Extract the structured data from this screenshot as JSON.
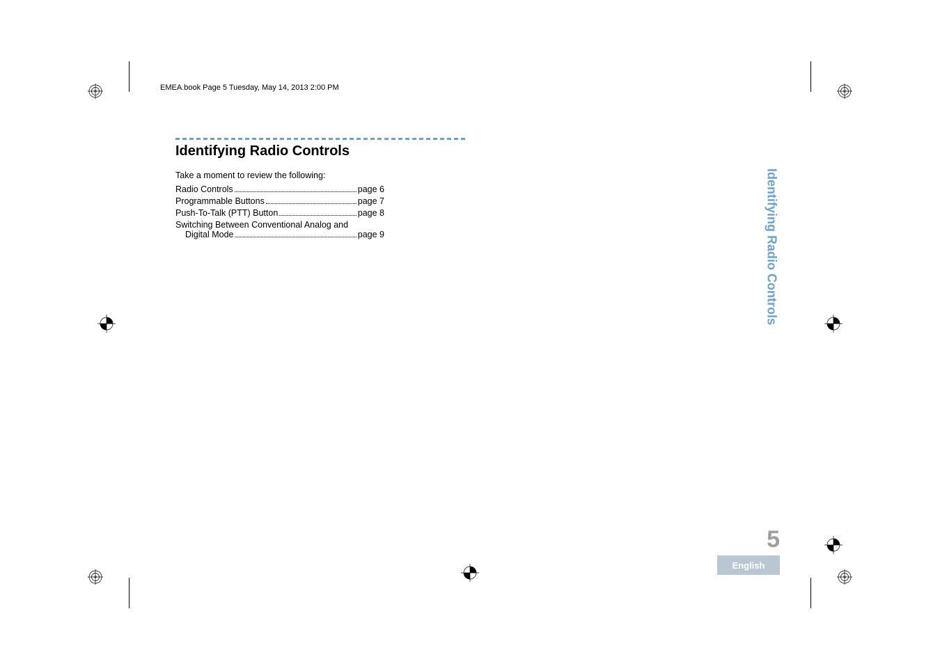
{
  "running_header": "EMEA.book  Page 5  Tuesday, May 14, 2013  2:00 PM",
  "content": {
    "title": "Identifying Radio Controls",
    "intro": "Take a moment to review the following:",
    "toc": [
      {
        "label": "Radio Controls",
        "page": "page 6"
      },
      {
        "label": "Programmable Buttons",
        "page": "page 7"
      },
      {
        "label": "Push-To-Talk (PTT) Button",
        "page": "page 8"
      }
    ],
    "toc_multi": {
      "line1": "Switching Between Conventional Analog and",
      "line2_label": "Digital Mode",
      "line2_page": "page 9"
    }
  },
  "side_tab": "Identifying Radio Controls",
  "footer": {
    "page_number": "5",
    "language": "English"
  }
}
